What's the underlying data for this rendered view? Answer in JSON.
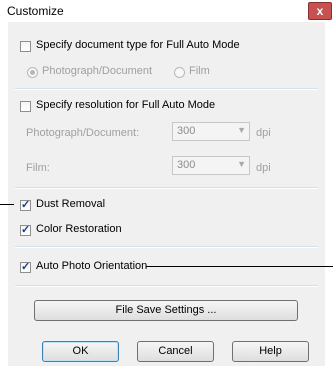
{
  "dialog": {
    "title": "Customize",
    "close_label": "x"
  },
  "doc_type": {
    "checkbox_label": "Specify document type for Full Auto Mode",
    "checked": false,
    "options": [
      {
        "label": "Photograph/Document",
        "selected": true
      },
      {
        "label": "Film",
        "selected": false
      }
    ]
  },
  "resolution": {
    "checkbox_label": "Specify resolution for Full Auto Mode",
    "checked": false,
    "rows": [
      {
        "label": "Photograph/Document:",
        "value": "300",
        "unit": "dpi"
      },
      {
        "label": "Film:",
        "value": "300",
        "unit": "dpi"
      }
    ]
  },
  "options": {
    "dust_removal": {
      "label": "Dust Removal",
      "checked": true
    },
    "color_restoration": {
      "label": "Color Restoration",
      "checked": true
    },
    "auto_photo_orientation": {
      "label": "Auto Photo Orientation",
      "checked": true
    }
  },
  "buttons": {
    "file_save_settings": "File Save Settings ...",
    "ok": "OK",
    "cancel": "Cancel",
    "help": "Help"
  },
  "icons": {
    "combo_arrow": "chevron-down-icon",
    "close": "close-icon"
  }
}
